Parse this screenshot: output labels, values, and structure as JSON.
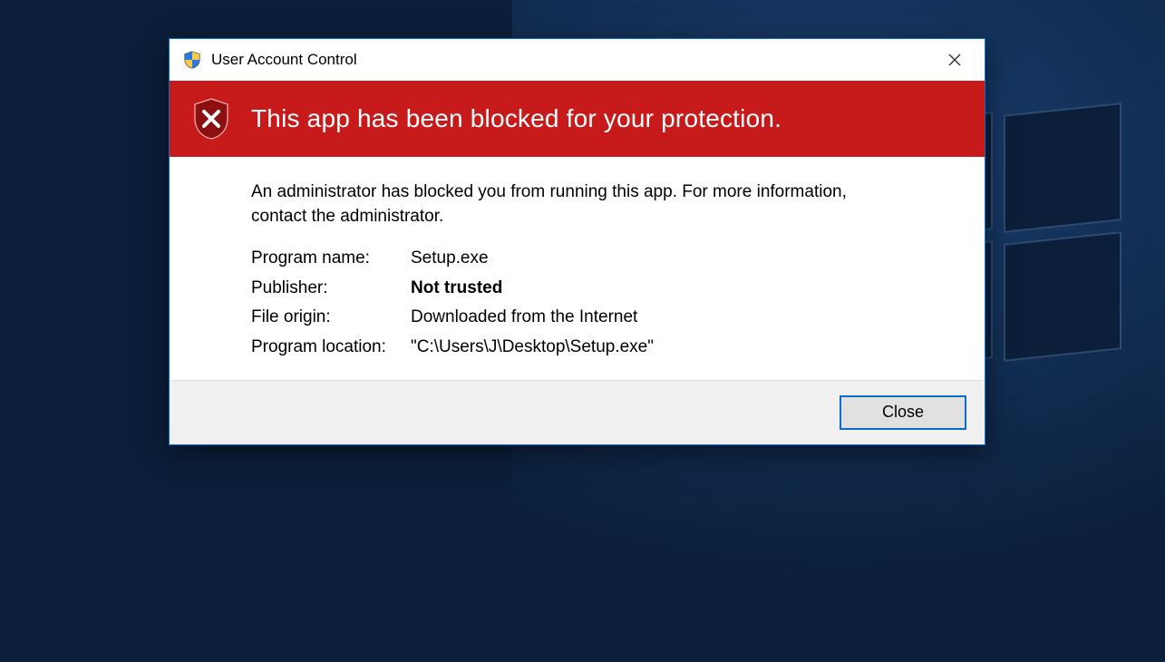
{
  "dialog": {
    "title": "User Account Control",
    "headline": "This app has been blocked for your protection.",
    "message": "An administrator has blocked you from running this app. For more information, contact the administrator.",
    "labels": {
      "program_name": "Program name:",
      "publisher": "Publisher:",
      "file_origin": "File origin:",
      "program_location": "Program location:"
    },
    "values": {
      "program_name": "Setup.exe",
      "publisher": "Not trusted",
      "file_origin": "Downloaded from the Internet",
      "program_location": "\"C:\\Users\\J\\Desktop\\Setup.exe\""
    },
    "buttons": {
      "close": "Close"
    }
  }
}
